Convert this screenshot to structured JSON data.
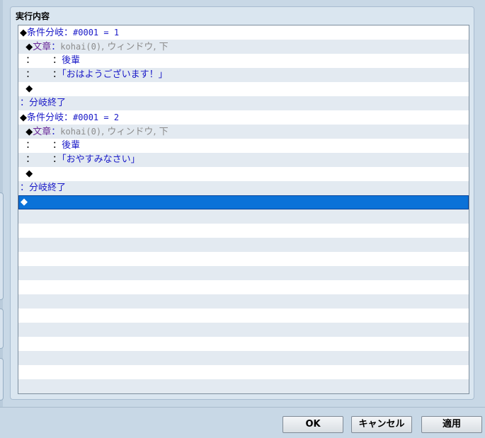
{
  "panel": {
    "title": "実行内容"
  },
  "rows": [
    {
      "segments": [
        {
          "t": "◆",
          "c": "black"
        },
        {
          "t": "条件分岐：",
          "c": "blue"
        },
        {
          "t": "#0001 = 1",
          "c": "blue mono"
        }
      ]
    },
    {
      "segments": [
        {
          "t": "  ◆",
          "c": "black"
        },
        {
          "t": "文章",
          "c": "purple"
        },
        {
          "t": "：",
          "c": "blue"
        },
        {
          "t": "kohai(0)",
          "c": "gray mono"
        },
        {
          "t": ", ウィンドウ, 下",
          "c": "gray"
        }
      ]
    },
    {
      "segments": [
        {
          "t": "  ：      ：",
          "c": "black"
        },
        {
          "t": "後輩",
          "c": "blue"
        }
      ]
    },
    {
      "segments": [
        {
          "t": "  ：      ：",
          "c": "black"
        },
        {
          "t": "「おはようございます！」",
          "c": "blue"
        }
      ]
    },
    {
      "segments": [
        {
          "t": "  ◆",
          "c": "black"
        }
      ]
    },
    {
      "segments": [
        {
          "t": "：",
          "c": "blue"
        },
        {
          "t": "分岐終了",
          "c": "blue"
        }
      ]
    },
    {
      "segments": [
        {
          "t": "◆",
          "c": "black"
        },
        {
          "t": "条件分岐：",
          "c": "blue"
        },
        {
          "t": "#0001 = 2",
          "c": "blue mono"
        }
      ]
    },
    {
      "segments": [
        {
          "t": "  ◆",
          "c": "black"
        },
        {
          "t": "文章",
          "c": "purple"
        },
        {
          "t": "：",
          "c": "blue"
        },
        {
          "t": "kohai(0)",
          "c": "gray mono"
        },
        {
          "t": ", ウィンドウ, 下",
          "c": "gray"
        }
      ]
    },
    {
      "segments": [
        {
          "t": "  ：      ：",
          "c": "black"
        },
        {
          "t": "後輩",
          "c": "blue"
        }
      ]
    },
    {
      "segments": [
        {
          "t": "  ：      ：",
          "c": "black"
        },
        {
          "t": "「おやすみなさい」",
          "c": "blue"
        }
      ]
    },
    {
      "segments": [
        {
          "t": "  ◆",
          "c": "black"
        }
      ]
    },
    {
      "segments": [
        {
          "t": "：",
          "c": "blue"
        },
        {
          "t": "分岐終了",
          "c": "blue"
        }
      ]
    },
    {
      "segments": [
        {
          "t": "◆",
          "c": "black"
        }
      ],
      "selected": true
    }
  ],
  "empty_rows": 13,
  "footer": {
    "ok_label": "OK",
    "cancel_label": "キャンセル",
    "apply_label": "適用"
  },
  "colors": {
    "background": "#c8d8e6",
    "selection": "#0b72d8",
    "command_text": "#1a1ac8",
    "message_label": "#6a2a9a",
    "param_text": "#8c8c8c"
  }
}
